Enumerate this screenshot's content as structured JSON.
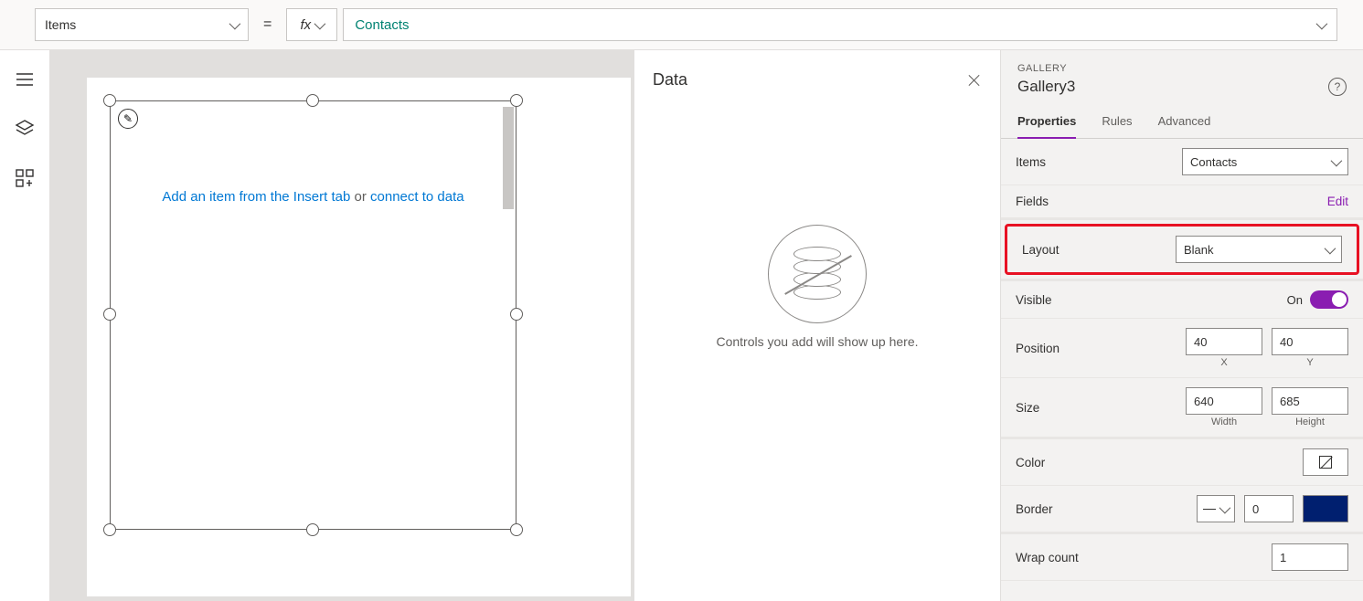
{
  "formulaBar": {
    "propertyName": "Items",
    "fxLabel": "fx",
    "formula": "Contacts"
  },
  "canvas": {
    "hintInsert": "Add an item from the Insert tab ",
    "hintOr": "or ",
    "hintConnect": "connect to data",
    "editIcon": "✎"
  },
  "dataPanel": {
    "title": "Data",
    "emptyText": "Controls you add will show up here."
  },
  "propsPanel": {
    "category": "GALLERY",
    "name": "Gallery3",
    "tabs": {
      "properties": "Properties",
      "rules": "Rules",
      "advanced": "Advanced"
    },
    "labels": {
      "items": "Items",
      "fields": "Fields",
      "fieldsEdit": "Edit",
      "layout": "Layout",
      "visible": "Visible",
      "visibleState": "On",
      "position": "Position",
      "size": "Size",
      "color": "Color",
      "border": "Border",
      "wrapCount": "Wrap count",
      "x": "X",
      "y": "Y",
      "width": "Width",
      "height": "Height"
    },
    "values": {
      "itemsSource": "Contacts",
      "layout": "Blank",
      "posX": "40",
      "posY": "40",
      "width": "640",
      "height": "685",
      "borderWidth": "0",
      "wrapCount": "1"
    }
  }
}
